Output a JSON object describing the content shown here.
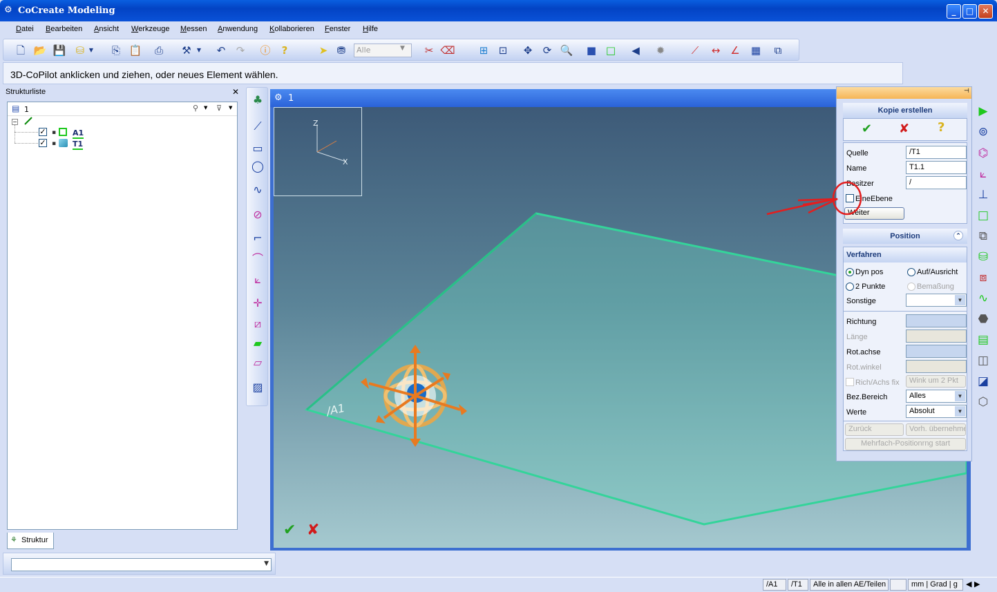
{
  "window": {
    "title": "CoCreate Modeling"
  },
  "menu": [
    "Datei",
    "Bearbeiten",
    "Ansicht",
    "Werkzeuge",
    "Messen",
    "Anwendung",
    "Kollaborieren",
    "Fenster",
    "Hilfe"
  ],
  "toolbar": {
    "filter_value": "Alle"
  },
  "message": "3D-CoPilot anklicken und ziehen, oder neues Element wählen.",
  "structure": {
    "title": "Strukturliste",
    "root": "1",
    "items": [
      "A1",
      "T1"
    ],
    "tab": "Struktur"
  },
  "viewport": {
    "title": "1",
    "axis_z": "Z",
    "axis_x": "X",
    "workplane_label": "/A1"
  },
  "dialog": {
    "title": "Kopie erstellen",
    "fields": {
      "quelle_label": "Quelle",
      "quelle_value": "/T1",
      "name_label": "Name",
      "name_value": "T1.1",
      "besitzer_label": "Besitzer",
      "besitzer_value": "/",
      "eine_ebene_label": "EineEbene",
      "weiter_label": "Weiter"
    },
    "position": {
      "title": "Position",
      "verfahren_title": "Verfahren",
      "dyn_pos": "Dyn pos",
      "auf_ausricht": "Auf/Ausricht",
      "zwei_punkte": "2 Punkte",
      "bemassung": "Bemaßung",
      "sonstige": "Sonstige",
      "richtung": "Richtung",
      "laenge": "Länge",
      "rot_achse": "Rot.achse",
      "rot_winkel": "Rot.winkel",
      "rich_achs_fix": "Rich/Achs fix",
      "wink_um_2_pkt": "Wink um 2 Pkt",
      "bez_bereich": "Bez.Bereich",
      "bez_bereich_value": "Alles",
      "werte": "Werte",
      "werte_value": "Absolut",
      "zurueck": "Zurück",
      "vorh_uebernehmen": "Vorh. übernehme",
      "mehrfach": "Mehrfach-Positionrng start"
    }
  },
  "status": {
    "ws1": "/A1",
    "ws2": "/T1",
    "scope": "Alle in allen AE/Teilen",
    "units": "mm | Grad | g"
  },
  "colors": {
    "accent": "#0a52d8",
    "ok": "#21a121",
    "cancel": "#d11a1a",
    "plane": "#3ed39a",
    "annotation": "#e31e1e"
  }
}
